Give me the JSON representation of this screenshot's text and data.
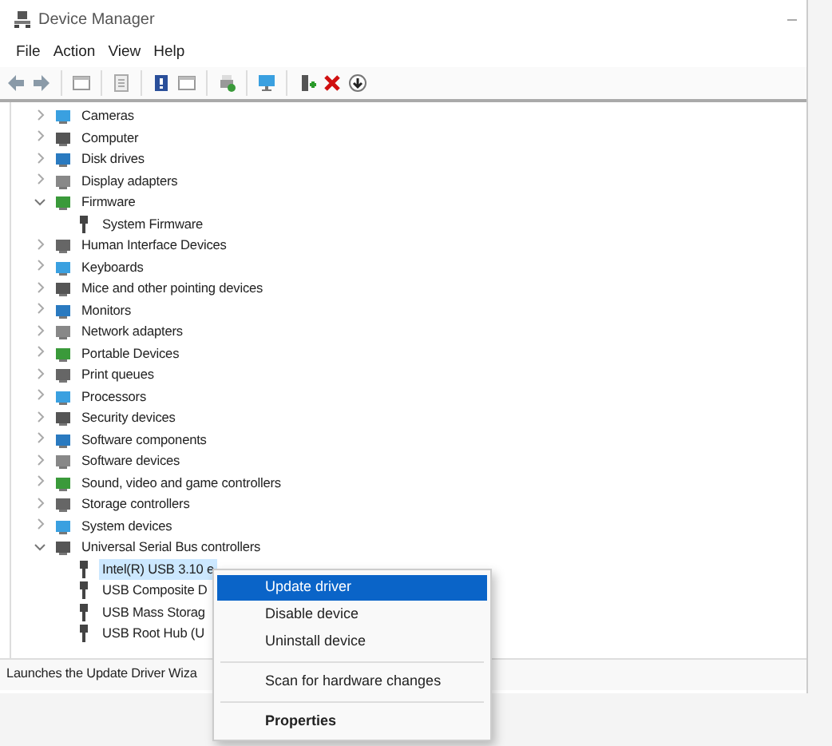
{
  "window": {
    "title": "Device Manager"
  },
  "menu": [
    {
      "label": "File"
    },
    {
      "label": "Action"
    },
    {
      "label": "View"
    },
    {
      "label": "Help"
    }
  ],
  "tree": [
    {
      "label": "Cameras",
      "expanded": false
    },
    {
      "label": "Computer",
      "expanded": false
    },
    {
      "label": "Disk drives",
      "expanded": false
    },
    {
      "label": "Display adapters",
      "expanded": false
    },
    {
      "label": "Firmware",
      "expanded": true,
      "children": [
        {
          "label": "System Firmware",
          "selected": false
        }
      ]
    },
    {
      "label": "Human Interface Devices",
      "expanded": false
    },
    {
      "label": "Keyboards",
      "expanded": false
    },
    {
      "label": "Mice and other pointing devices",
      "expanded": false
    },
    {
      "label": "Monitors",
      "expanded": false
    },
    {
      "label": "Network adapters",
      "expanded": false
    },
    {
      "label": "Portable Devices",
      "expanded": false
    },
    {
      "label": "Print queues",
      "expanded": false
    },
    {
      "label": "Processors",
      "expanded": false
    },
    {
      "label": "Security devices",
      "expanded": false
    },
    {
      "label": "Software components",
      "expanded": false
    },
    {
      "label": "Software devices",
      "expanded": false
    },
    {
      "label": "Sound, video and game controllers",
      "expanded": false
    },
    {
      "label": "Storage controllers",
      "expanded": false
    },
    {
      "label": "System devices",
      "expanded": false
    },
    {
      "label": "Universal Serial Bus controllers",
      "expanded": true,
      "children": [
        {
          "label": "Intel(R) USB 3.10 e",
          "selected": true
        },
        {
          "label": "USB Composite D",
          "selected": false
        },
        {
          "label": "USB Mass Storag",
          "selected": false
        },
        {
          "label": "USB Root Hub (U",
          "selected": false
        }
      ]
    }
  ],
  "context_menu": [
    {
      "kind": "item",
      "label": "Update driver",
      "selected": true,
      "default": false
    },
    {
      "kind": "item",
      "label": "Disable device",
      "selected": false,
      "default": false
    },
    {
      "kind": "item",
      "label": "Uninstall device",
      "selected": false,
      "default": false
    },
    {
      "kind": "separator"
    },
    {
      "kind": "item",
      "label": "Scan for hardware changes",
      "selected": false,
      "default": false
    },
    {
      "kind": "separator"
    },
    {
      "kind": "item",
      "label": "Properties",
      "selected": false,
      "default": true
    }
  ],
  "status_bar": "Launches the Update Driver Wiza"
}
